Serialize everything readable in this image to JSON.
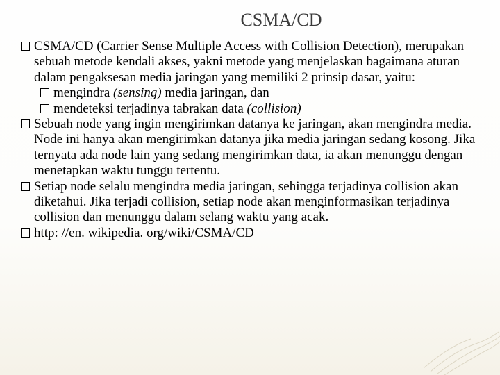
{
  "title": "CSMA/CD",
  "bullets": [
    {
      "level": 1,
      "segments": [
        {
          "t": "CSMA/CD (Carrier Sense Multiple Access with Collision Detection), merupakan sebuah metode kendali akses, yakni metode yang menjelaskan bagaimana aturan dalam pengaksesan media jaringan yang memiliki 2 prinsip dasar, yaitu:"
        }
      ]
    },
    {
      "level": 2,
      "segments": [
        {
          "t": "mengindra "
        },
        {
          "t": "(sensing)",
          "italic": true
        },
        {
          "t": " media jaringan, dan"
        }
      ]
    },
    {
      "level": 2,
      "segments": [
        {
          "t": "mendeteksi terjadinya tabrakan data "
        },
        {
          "t": "(collision)",
          "italic": true
        }
      ]
    },
    {
      "level": 1,
      "segments": [
        {
          "t": "Sebuah node yang ingin mengirimkan datanya ke jaringan, akan mengindra media. Node ini hanya akan mengirimkan datanya jika media jaringan sedang kosong. Jika ternyata ada node lain yang sedang mengirimkan data, ia akan menunggu dengan menetapkan waktu tunggu tertentu."
        }
      ]
    },
    {
      "level": 1,
      "segments": [
        {
          "t": "Setiap node selalu mengindra media jaringan, sehingga terjadinya collision akan diketahui. Jika terjadi collision, setiap node akan menginformasikan terjadinya collision dan menunggu dalam selang waktu yang acak."
        }
      ]
    },
    {
      "level": 1,
      "segments": [
        {
          "t": "http: //en. wikipedia. org/wiki/CSMA/CD",
          "link": true
        }
      ]
    }
  ]
}
